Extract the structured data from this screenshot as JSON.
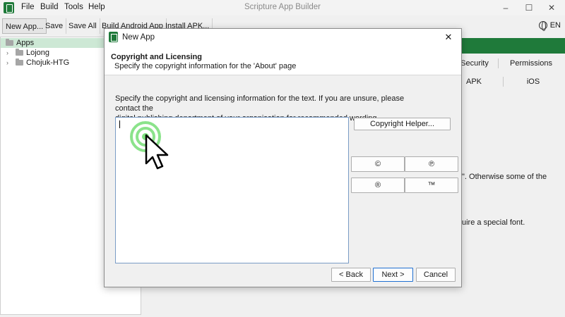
{
  "window": {
    "title": "Scripture App Builder",
    "menu": [
      "File",
      "Build",
      "Tools",
      "Help"
    ],
    "controls": {
      "minimize": "–",
      "maximize": "☐",
      "close": "✕"
    }
  },
  "toolbar": {
    "new_app": "New App...",
    "save": "Save",
    "save_all": "Save All",
    "build_android": "Build Android App",
    "install_apk": "Install APK...",
    "language": "EN"
  },
  "sidebar": {
    "items": [
      {
        "label": "Apps",
        "selected": true
      },
      {
        "label": "Lojong",
        "selected": false
      },
      {
        "label": "Chojuk-HTG",
        "selected": false
      }
    ],
    "expander": "›"
  },
  "right_pane": {
    "tabs_row1": [
      "Security",
      "Permissions"
    ],
    "tabs_row2": [
      "APK",
      "iOS"
    ],
    "text1": "\". Otherwise some of the",
    "text2": "uire a special font."
  },
  "dialog": {
    "title": "New App",
    "close": "✕",
    "heading": "Copyright and Licensing",
    "subheading": "Specify the copyright information for the 'About' page",
    "instructions_line1": "Specify the copyright and licensing information for the text. If you are unsure, please contact the",
    "instructions_line2": "digital publishing department of your organisation for recommended wording.",
    "copyright_value": "",
    "copyright_helper": "Copyright Helper...",
    "symbols": [
      "©",
      "℗",
      "®",
      "™"
    ],
    "back": "< Back",
    "next": "Next >",
    "cancel": "Cancel"
  },
  "colors": {
    "brand_green": "#1f7a3a",
    "selection": "#cde8d5",
    "click_ring": "#7ee07e"
  }
}
